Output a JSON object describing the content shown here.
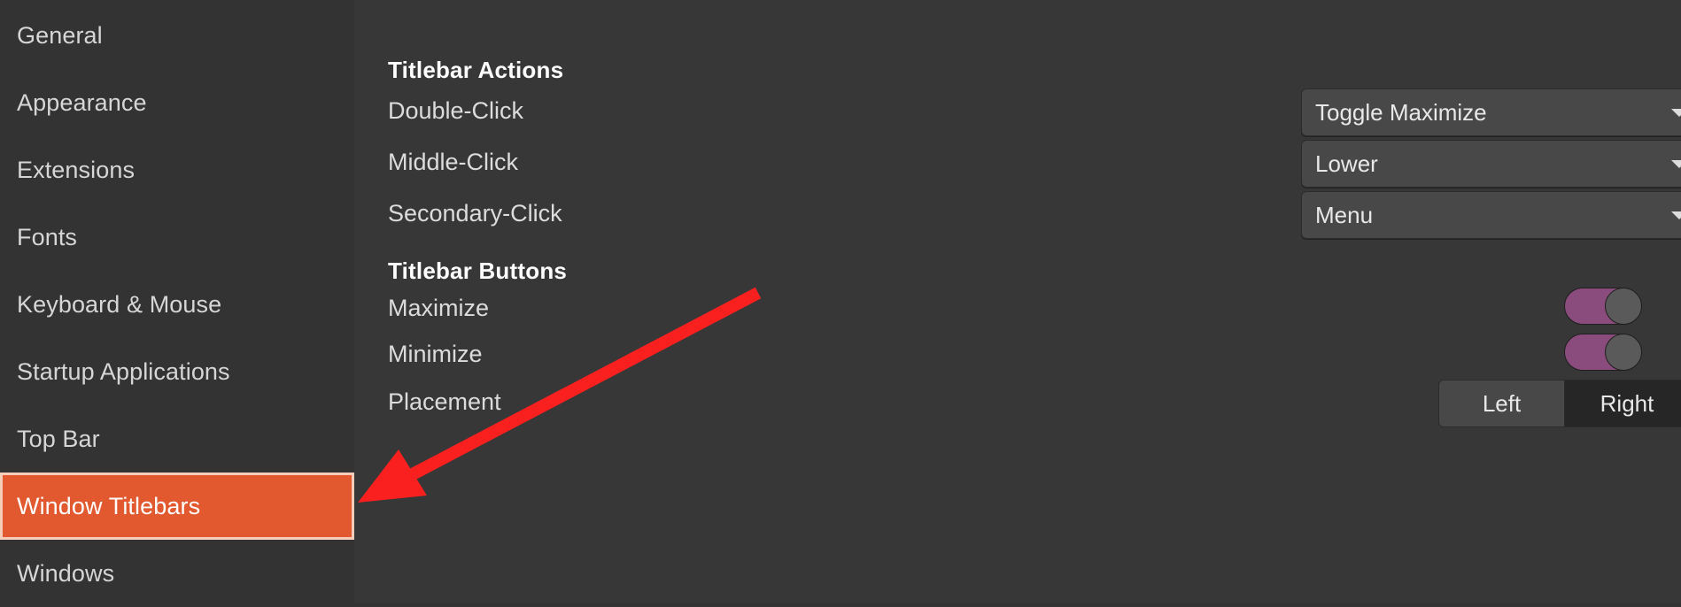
{
  "sidebar": {
    "items": [
      {
        "label": "General",
        "selected": false
      },
      {
        "label": "Appearance",
        "selected": false
      },
      {
        "label": "Extensions",
        "selected": false
      },
      {
        "label": "Fonts",
        "selected": false
      },
      {
        "label": "Keyboard & Mouse",
        "selected": false
      },
      {
        "label": "Startup Applications",
        "selected": false
      },
      {
        "label": "Top Bar",
        "selected": false
      },
      {
        "label": "Window Titlebars",
        "selected": true
      },
      {
        "label": "Windows",
        "selected": false
      }
    ],
    "selected_label": "Window Titlebars",
    "selected_bg": "#e2582f",
    "selected_border": "#f7cdb9"
  },
  "main": {
    "sections": [
      {
        "title": "Titlebar Actions",
        "rows": [
          {
            "label": "Double-Click",
            "control": "dropdown",
            "value": "Toggle Maximize"
          },
          {
            "label": "Middle-Click",
            "control": "dropdown",
            "value": "Lower"
          },
          {
            "label": "Secondary-Click",
            "control": "dropdown",
            "value": "Menu"
          }
        ]
      },
      {
        "title": "Titlebar Buttons",
        "rows": [
          {
            "label": "Maximize",
            "control": "toggle",
            "value": "on"
          },
          {
            "label": "Minimize",
            "control": "toggle",
            "value": "on"
          },
          {
            "label": "Placement",
            "control": "segmented",
            "options": [
              "Left",
              "Right"
            ],
            "value": "Right"
          }
        ]
      }
    ],
    "titlebar_actions_title": "Titlebar Actions",
    "titlebar_buttons_title": "Titlebar Buttons",
    "label_double_click": "Double-Click",
    "label_middle_click": "Middle-Click",
    "label_secondary_click": "Secondary-Click",
    "label_maximize": "Maximize",
    "label_minimize": "Minimize",
    "label_placement": "Placement",
    "value_double_click": "Toggle Maximize",
    "value_middle_click": "Lower",
    "value_secondary_click": "Menu",
    "segment_left": "Left",
    "segment_right": "Right"
  },
  "theme": {
    "window_bg": "#333333",
    "content_bg": "#373737",
    "text": "#dcdcdc",
    "accent_orange": "#e2582f",
    "toggle_on": "#8a4b7d",
    "toggle_knob": "#5a5a5a",
    "annotation_red": "#fa2020"
  },
  "annotation": {
    "type": "arrow",
    "color": "#fa2020",
    "points_to": "Window Titlebars"
  }
}
